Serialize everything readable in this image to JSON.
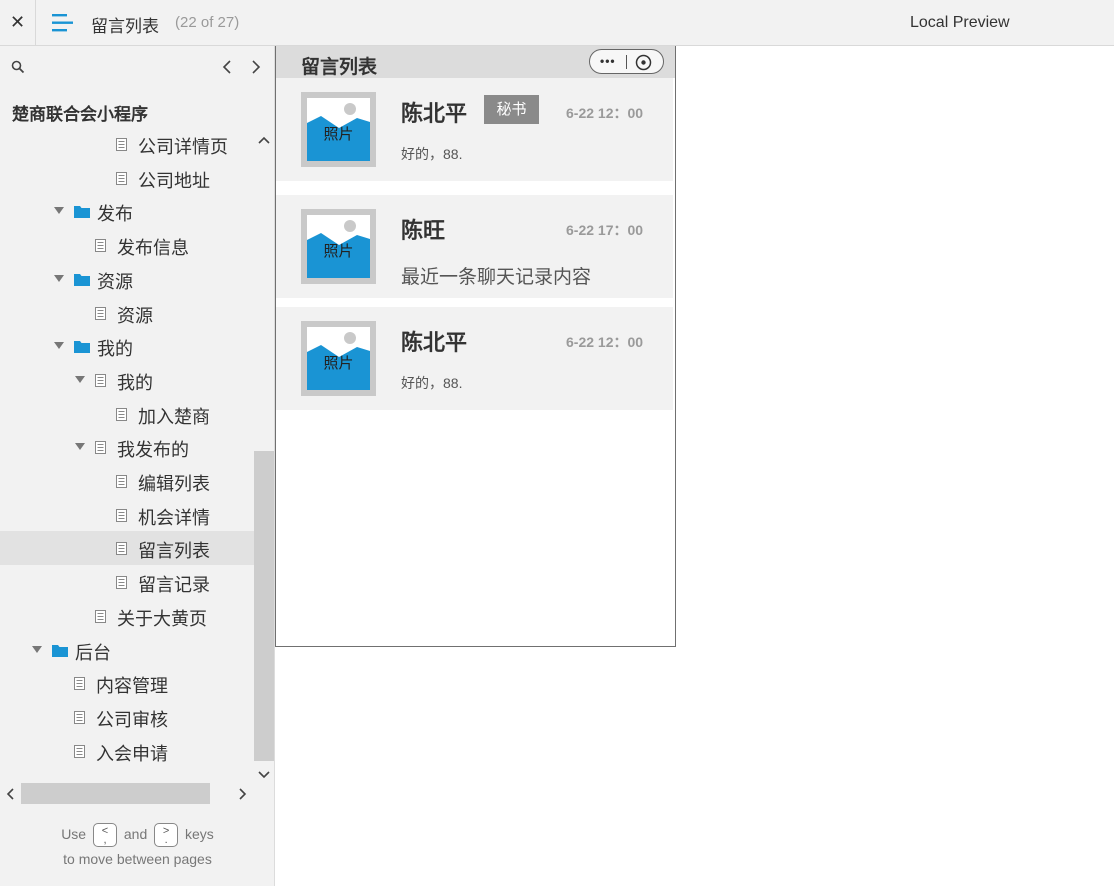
{
  "topbar": {
    "close_glyph": "✕",
    "page_title": "留言列表",
    "page_count": "(22 of 27)",
    "preview_label": "Local Preview",
    "accent_color": "#1a94d4"
  },
  "sidebar": {
    "project_title": "楚商联合会小程序",
    "tree": [
      {
        "label": "公司详情页",
        "type": "page",
        "level": 4
      },
      {
        "label": "公司地址",
        "type": "page",
        "level": 4
      },
      {
        "label": "发布",
        "type": "folder",
        "level": 2,
        "expanded": true
      },
      {
        "label": "发布信息",
        "type": "page",
        "level": 3
      },
      {
        "label": "资源",
        "type": "folder",
        "level": 2,
        "expanded": true
      },
      {
        "label": "资源",
        "type": "page",
        "level": 3
      },
      {
        "label": "我的",
        "type": "folder",
        "level": 2,
        "expanded": true
      },
      {
        "label": "我的",
        "type": "page",
        "level": 3,
        "expanded": true
      },
      {
        "label": "加入楚商",
        "type": "page",
        "level": 4
      },
      {
        "label": "我发布的",
        "type": "page",
        "level": 3,
        "expanded": true
      },
      {
        "label": "编辑列表",
        "type": "page",
        "level": 4
      },
      {
        "label": "机会详情",
        "type": "page",
        "level": 4
      },
      {
        "label": "留言列表",
        "type": "page",
        "level": 4,
        "selected": true
      },
      {
        "label": "留言记录",
        "type": "page",
        "level": 4
      },
      {
        "label": "关于大黄页",
        "type": "page",
        "level": 3
      },
      {
        "label": "后台",
        "type": "folder",
        "level": 1,
        "expanded": true
      },
      {
        "label": "内容管理",
        "type": "page",
        "level": 2
      },
      {
        "label": "公司审核",
        "type": "page",
        "level": 2
      },
      {
        "label": "入会申请",
        "type": "page",
        "level": 2
      }
    ],
    "hint": {
      "use": "Use",
      "prev_key": "<\n,",
      "and": "and",
      "next_key": ">\n.",
      "keys": "keys",
      "line2": "to move between pages"
    },
    "folder_color": "#1a94d4"
  },
  "preview": {
    "header_title": "留言列表",
    "capsule_dots": "•••",
    "messages": [
      {
        "name": "陈北平",
        "role": "秘书",
        "time": "6-22 12：00",
        "text": "好的，88.",
        "photo_label": "照片"
      },
      {
        "name": "陈旺",
        "role": "",
        "time": "6-22 17：00",
        "text": "最近一条聊天记录内容",
        "photo_label": "照片"
      },
      {
        "name": "陈北平",
        "role": "",
        "time": "6-22 12：00",
        "text": "好的，88.",
        "photo_label": "照片"
      }
    ],
    "photo_color": "#1a94d4"
  }
}
